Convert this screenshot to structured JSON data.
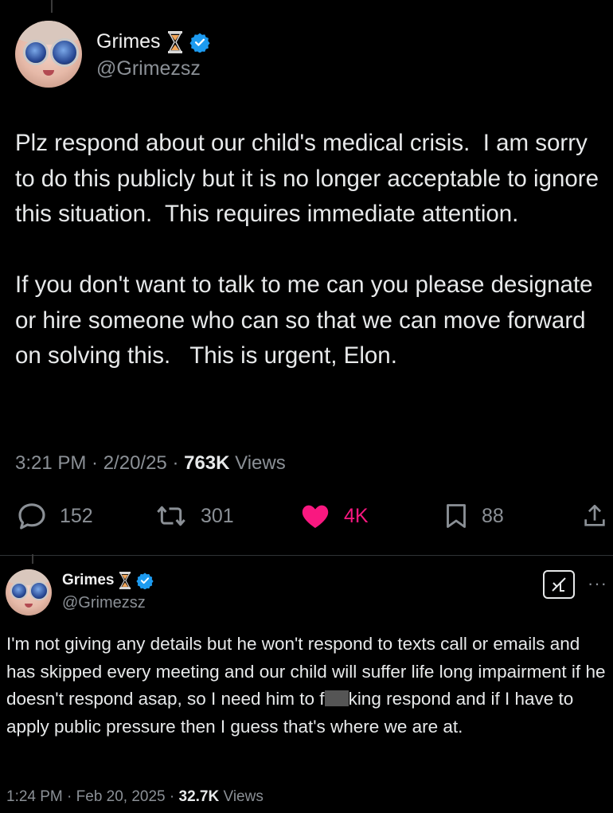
{
  "tweet1": {
    "name": "Grimes",
    "name_emoji": "hourglass-icon",
    "handle": "@Grimezsz",
    "body": "Plz respond about our child's medical crisis.  I am sorry to do this publicly but it is no longer acceptable to ignore this situation.  This requires immediate attention.\n\nIf you don't want to talk to me can you please designate or hire someone who can so that we can move forward on solving this.   This is urgent, Elon.",
    "time": "3:21 PM · 2/20/25 · ",
    "views_count": "763K",
    "views_label": " Views",
    "replies": "152",
    "reposts": "301",
    "likes": "4K",
    "bookmarks": "88"
  },
  "tweet2": {
    "name": "Grimes",
    "handle": "@Grimezsz",
    "body_before": "I'm not giving any details but he won't respond to texts call or emails and has skipped every meeting and our child will suffer life long impairment if he doesn't respond asap, so I need him to f",
    "body_after": "king respond and if I have to apply public pressure then I guess that's where we are at.",
    "more": "···",
    "time": "1:24 PM · Feb 20, 2025 · ",
    "views_count": "32.7K",
    "views_label": " Views"
  },
  "colors": {
    "background": "#000000",
    "text": "#e7e9ea",
    "secondary": "#8b9096",
    "verified": "#1d9bf0",
    "like": "#f91880"
  }
}
